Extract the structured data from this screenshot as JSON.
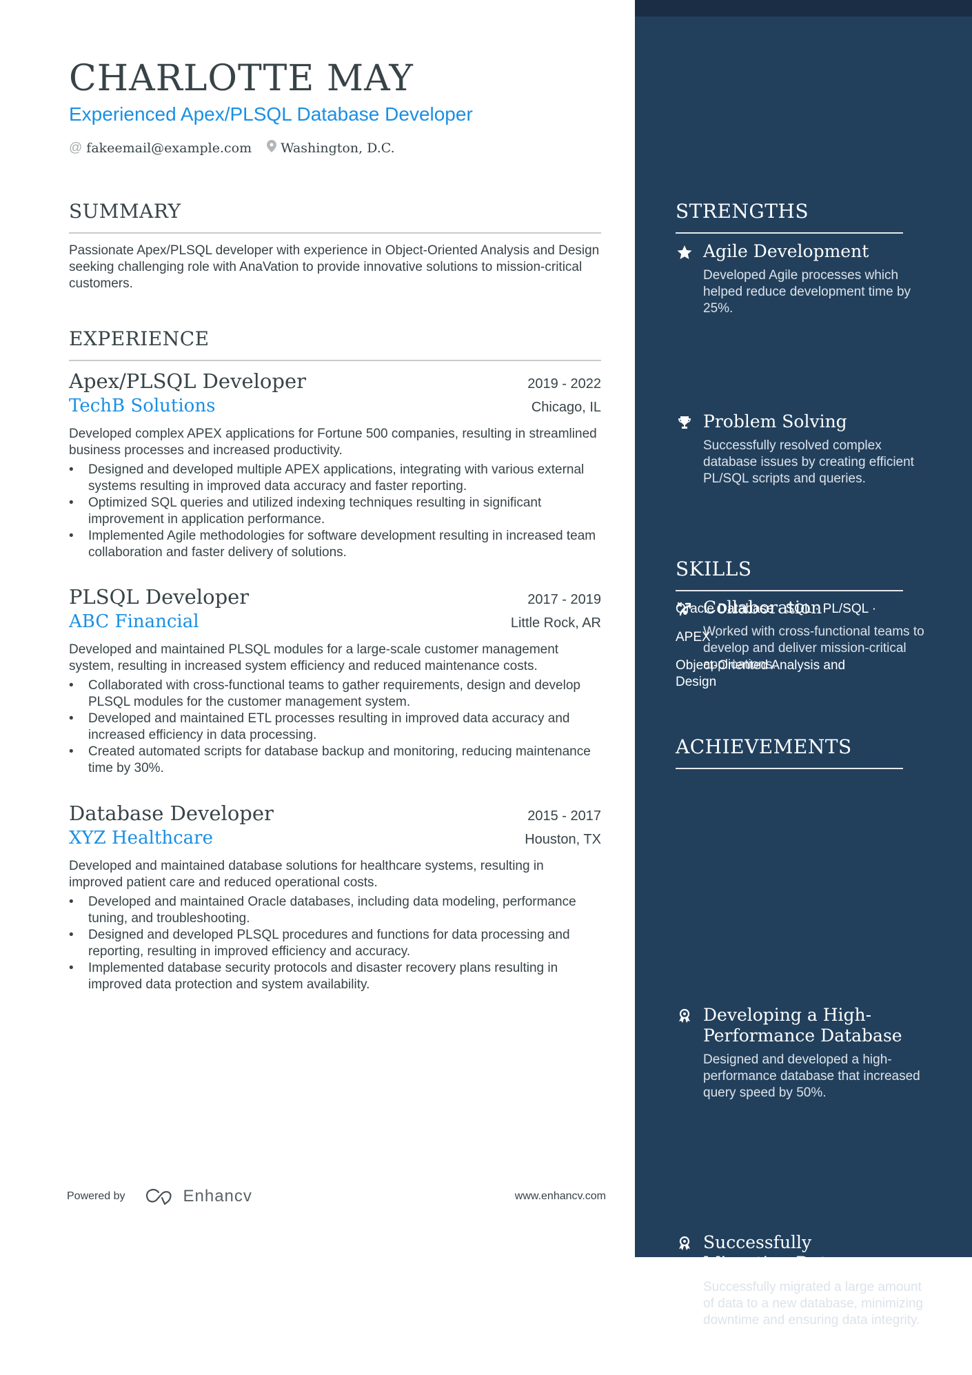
{
  "header": {
    "name": "CHARLOTTE MAY",
    "title": "Experienced Apex/PLSQL Database Developer",
    "email_icon": "at-icon",
    "email": "fakeemail@example.com",
    "location_icon": "location-pin-icon",
    "location": "Washington, D.C."
  },
  "summary": {
    "heading": "SUMMARY",
    "text": "Passionate Apex/PLSQL developer with experience in Object-Oriented Analysis and Design seeking challenging role with AnaVation to provide innovative solutions to mission-critical customers."
  },
  "experience": {
    "heading": "EXPERIENCE",
    "jobs": [
      {
        "role": "Apex/PLSQL Developer",
        "dates": "2019 - 2022",
        "company": "TechB Solutions",
        "location": "Chicago, IL",
        "description": "Developed complex APEX applications for Fortune 500 companies, resulting in streamlined business processes and increased productivity.",
        "bullets": [
          "Designed and developed multiple APEX applications, integrating with various external systems resulting in improved data accuracy and faster reporting.",
          "Optimized SQL queries and utilized indexing techniques resulting in significant improvement in application performance.",
          "Implemented Agile methodologies for software development resulting in increased team collaboration and faster delivery of solutions."
        ]
      },
      {
        "role": "PLSQL Developer",
        "dates": "2017 - 2019",
        "company": "ABC Financial",
        "location": "Little Rock, AR",
        "description": "Developed and maintained PLSQL modules for a large-scale customer management system, resulting in increased system efficiency and reduced maintenance costs.",
        "bullets": [
          "Collaborated with cross-functional teams to gather requirements, design and develop PLSQL modules for the customer management system.",
          "Developed and maintained ETL processes resulting in improved data accuracy and increased efficiency in data processing.",
          "Created automated scripts for database backup and monitoring, reducing maintenance time by 30%."
        ]
      },
      {
        "role": "Database Developer",
        "dates": "2015 - 2017",
        "company": "XYZ Healthcare",
        "location": "Houston, TX",
        "description": "Developed and maintained database solutions for healthcare systems, resulting in improved patient care and reduced operational costs.",
        "bullets": [
          "Developed and maintained Oracle databases, including data modeling, performance tuning, and troubleshooting.",
          "Designed and developed PLSQL procedures and functions for data processing and reporting, resulting in improved efficiency and accuracy.",
          "Implemented database security protocols and disaster recovery plans resulting in improved data protection and system availability."
        ]
      }
    ]
  },
  "strengths": {
    "heading": "STRENGTHS",
    "items": [
      {
        "icon": "star-icon",
        "title": "Agile Development",
        "description": "Developed Agile processes which helped reduce development time by 25%."
      },
      {
        "icon": "trophy-icon",
        "title": "Problem Solving",
        "description": "Successfully resolved complex database issues by creating efficient PL/SQL scripts and queries."
      },
      {
        "icon": "strategy-icon",
        "title": "Collaboration",
        "description": "Worked with cross-functional teams to develop and deliver mission-critical applications."
      }
    ]
  },
  "skills": {
    "heading": "SKILLS",
    "lines": [
      "Oracle Database · SQL · PL/SQL ·",
      "APEX ·",
      "Object-Oriented Analysis and Design"
    ]
  },
  "achievements": {
    "heading": "ACHIEVEMENTS",
    "items": [
      {
        "icon": "award-ribbon-icon",
        "title": "Developing a High-Performance Database",
        "description": "Designed and developed a high-performance database that increased query speed by 50%."
      },
      {
        "icon": "award-ribbon-icon",
        "title": "Successfully Migrating Data",
        "description": "Successfully migrated a large amount of data to a new database, minimizing downtime and ensuring data integrity."
      }
    ]
  },
  "footer": {
    "powered_by": "Powered by",
    "brand": "Enhancv",
    "website": "www.enhancv.com"
  },
  "colors": {
    "accent": "#1a8fe3",
    "text": "#384347",
    "sidebar_bg": "#22405c",
    "sidebar_top": "#1a2d44"
  }
}
